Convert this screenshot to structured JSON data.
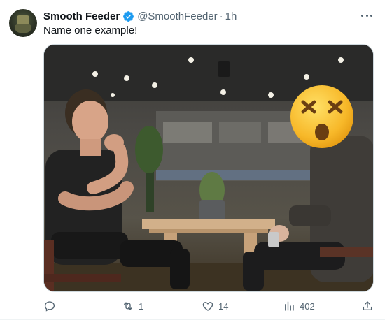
{
  "author": {
    "name": "Smooth Feeder",
    "handle": "@SmoothFeeder",
    "separator": "·",
    "time": "1h"
  },
  "tweet": {
    "text": "Name one example!"
  },
  "media": {
    "emoji_overlay": "astonished-face-icon"
  },
  "actions": {
    "replies": "",
    "retweets": "1",
    "likes": "14",
    "views": "402"
  },
  "colors": {
    "verified": "#1d9bf0",
    "secondary_text": "#536471",
    "border": "#cfd9de"
  }
}
